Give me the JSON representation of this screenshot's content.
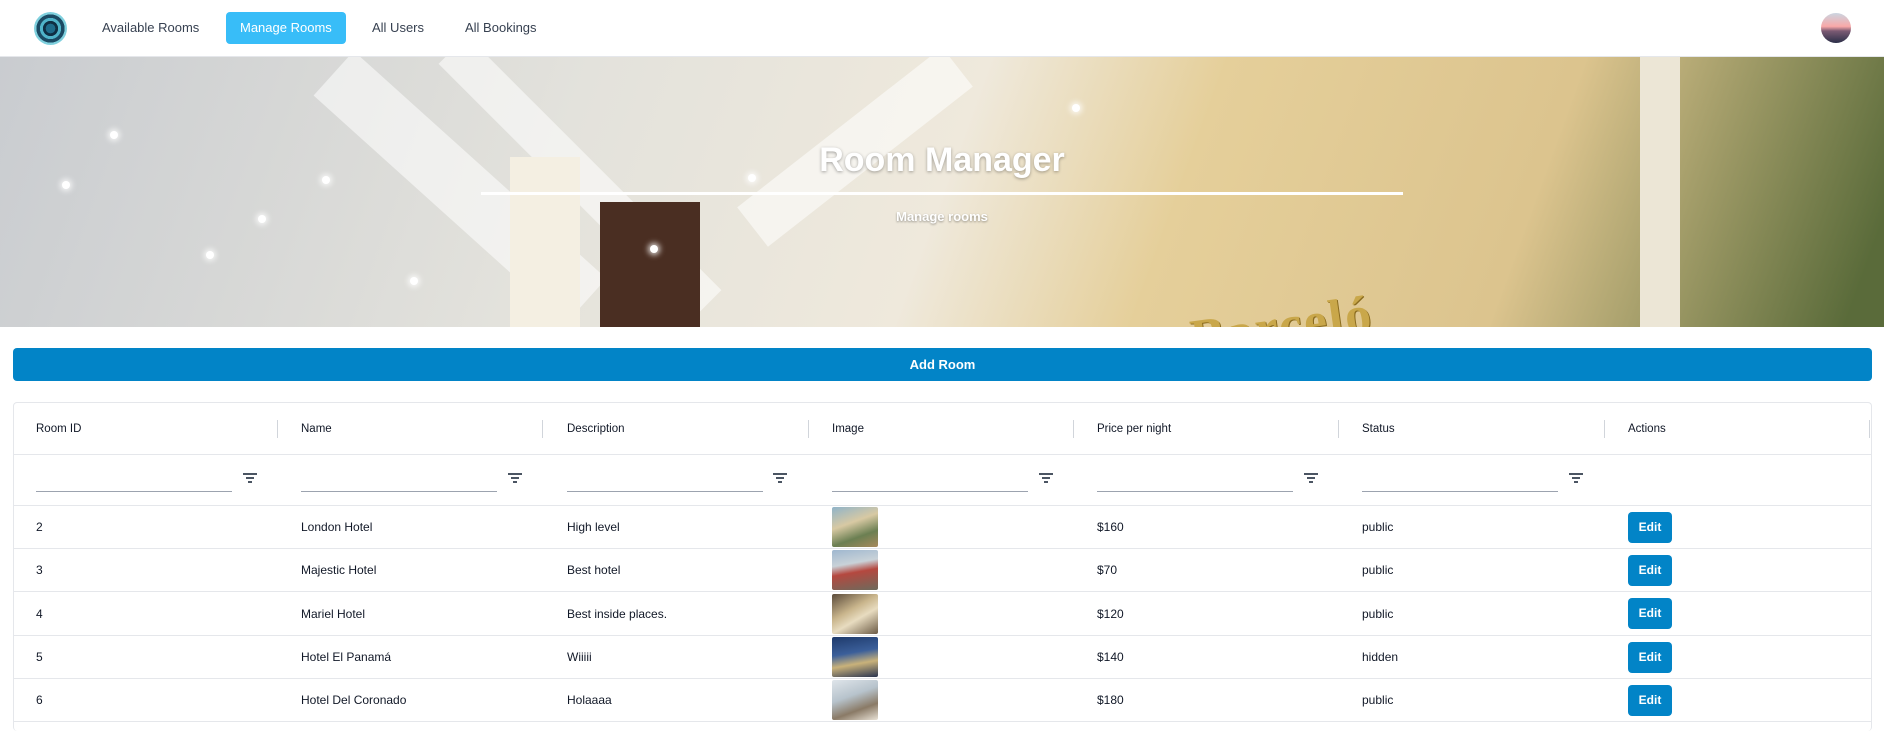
{
  "nav": {
    "links": [
      {
        "label": "Available Rooms",
        "active": false
      },
      {
        "label": "Manage Rooms",
        "active": true
      },
      {
        "label": "All Users",
        "active": false
      },
      {
        "label": "All Bookings",
        "active": false
      }
    ],
    "active_color": "#38bdf8"
  },
  "hero": {
    "title": "Room Manager",
    "subtitle": "Manage rooms",
    "sign_text": "Barceló"
  },
  "add_button": {
    "label": "Add Room",
    "color": "#0284c7"
  },
  "table": {
    "columns": [
      "Room ID",
      "Name",
      "Description",
      "Image",
      "Price per night",
      "Status",
      "Actions"
    ],
    "rows": [
      {
        "id": "2",
        "name": "London Hotel",
        "description": "High level",
        "price": "$160",
        "status": "public",
        "action": "Edit"
      },
      {
        "id": "3",
        "name": "Majestic Hotel",
        "description": "Best hotel",
        "price": "$70",
        "status": "public",
        "action": "Edit"
      },
      {
        "id": "4",
        "name": "Mariel Hotel",
        "description": "Best inside places.",
        "price": "$120",
        "status": "public",
        "action": "Edit"
      },
      {
        "id": "5",
        "name": "Hotel El Panamá",
        "description": "Wiiiii",
        "price": "$140",
        "status": "hidden",
        "action": "Edit"
      },
      {
        "id": "6",
        "name": "Hotel Del Coronado",
        "description": "Holaaaa",
        "price": "$180",
        "status": "public",
        "action": "Edit"
      }
    ]
  }
}
